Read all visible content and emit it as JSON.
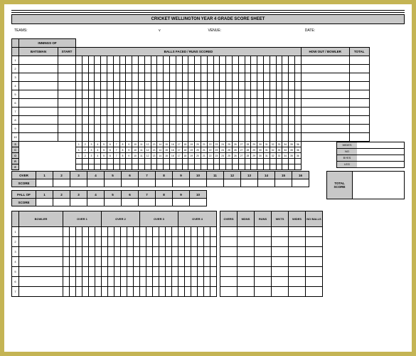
{
  "header": {
    "title": "CRICKET WELLINGTON YEAR 4 GRADE SCORE SHEET"
  },
  "meta": {
    "teams_label": "TEAMS:",
    "vs": "v",
    "venue_label": "VENUE:",
    "date_label": "DATE:"
  },
  "batting": {
    "innings_label": "INNINGS OF",
    "headers": {
      "batsman": "BATSMAN",
      "start": "START",
      "balls": "BALLS FACED / RUNS SCORED",
      "howout": "HOW OUT / BOWLER",
      "total": "TOTAL"
    },
    "row_nums": [
      "1",
      "2",
      "3",
      "4",
      "5",
      "6",
      "7",
      "8",
      "9",
      "10"
    ],
    "num_ball_cols": 36,
    "score_label_chars": [
      "S",
      "C",
      "O",
      "R",
      "E"
    ],
    "ticks_1_40": [
      "1",
      "2",
      "3",
      "4",
      "5",
      "6",
      "7",
      "8",
      "9",
      "10",
      "11",
      "12",
      "13",
      "14",
      "15",
      "16",
      "17",
      "18",
      "19",
      "20",
      "21",
      "22",
      "23",
      "24",
      "25",
      "26",
      "27",
      "28",
      "29",
      "30",
      "31",
      "32",
      "33",
      "34",
      "35",
      "36",
      "37",
      "38",
      "39",
      "40"
    ]
  },
  "extras": {
    "wides": "WIDES",
    "no": "NO",
    "byes": "BYES",
    "leg": "LEG"
  },
  "overs": {
    "label_over": "OVER",
    "label_score": "SCORE",
    "nums": [
      "1",
      "2",
      "3",
      "4",
      "5",
      "6",
      "7",
      "8",
      "9",
      "10",
      "11",
      "12",
      "13",
      "14",
      "15",
      "16"
    ]
  },
  "fall": {
    "label_fall": "FALL OF",
    "label_score": "SCORE",
    "nums": [
      "1",
      "2",
      "3",
      "4",
      "5",
      "6",
      "7",
      "8",
      "9",
      "10"
    ]
  },
  "total_score": {
    "label": "TOTAL SCORE"
  },
  "bowling": {
    "headers": {
      "bowler": "BOWLER",
      "over1": "OVER 1",
      "over2": "OVER 2",
      "over3": "OVER 3",
      "over4": "OVER 4"
    },
    "summary_headers": {
      "overs": "OVERS",
      "mdns": "MDNS",
      "runs": "RUNS",
      "wkts": "WKTS",
      "wides": "WIDES",
      "noballs": "NO BALLS"
    },
    "row_nums": [
      "1",
      "2",
      "3",
      "4",
      "5",
      "6",
      "7"
    ],
    "balls_per_over": 6
  }
}
